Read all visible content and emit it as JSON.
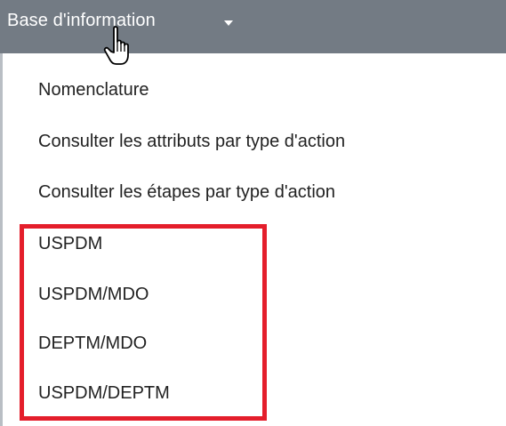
{
  "menu": {
    "title": "Base d'information",
    "caret_icon": "caret-down-icon",
    "items": [
      {
        "label": "Nomenclature"
      },
      {
        "label": "Consulter les attributs par type d'action"
      },
      {
        "label": "Consulter les étapes par type d'action"
      },
      {
        "label": "USPDM"
      },
      {
        "label": "USPDM/MDO"
      },
      {
        "label": "DEPTM/MDO"
      },
      {
        "label": "USPDM/DEPTM"
      }
    ]
  },
  "cursor": "hand-pointer-icon",
  "highlight": {
    "color": "#e41e2b",
    "covers_items": [
      "USPDM",
      "USPDM/MDO",
      "DEPTM/MDO",
      "USPDM/DEPTM"
    ]
  },
  "colors": {
    "header_bg": "#737b84",
    "header_text": "#ffffff",
    "item_text": "#222222"
  }
}
